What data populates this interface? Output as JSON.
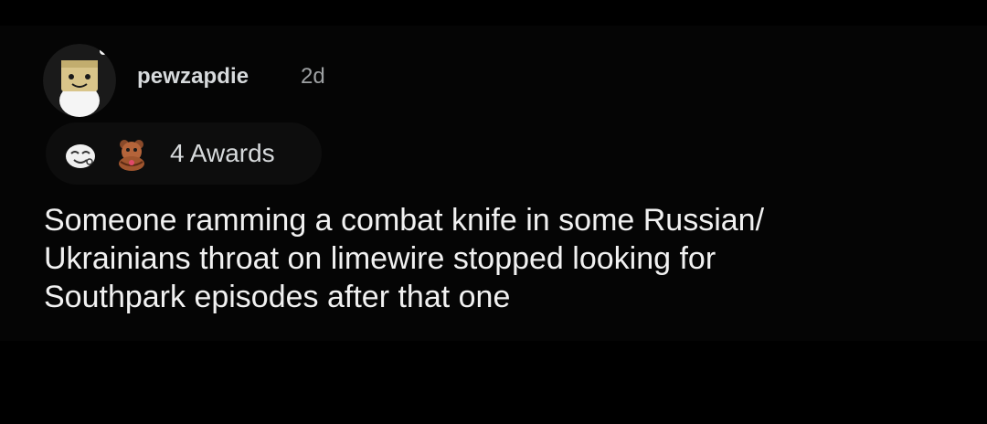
{
  "comment": {
    "username": "pewzapdie",
    "timestamp": "2d",
    "awards_label": "4 Awards",
    "award_icons": [
      "hehe-award-icon",
      "hugz-award-icon"
    ],
    "body_lines": [
      "Someone ramming a combat knife in some Russian/",
      "Ukrainians throat on limewire stopped looking for",
      "Southpark episodes after that one"
    ]
  },
  "colors": {
    "background": "#000000",
    "text": "#f1f1f1",
    "muted": "#9ea1a3",
    "pill": "#0d0d0d"
  }
}
